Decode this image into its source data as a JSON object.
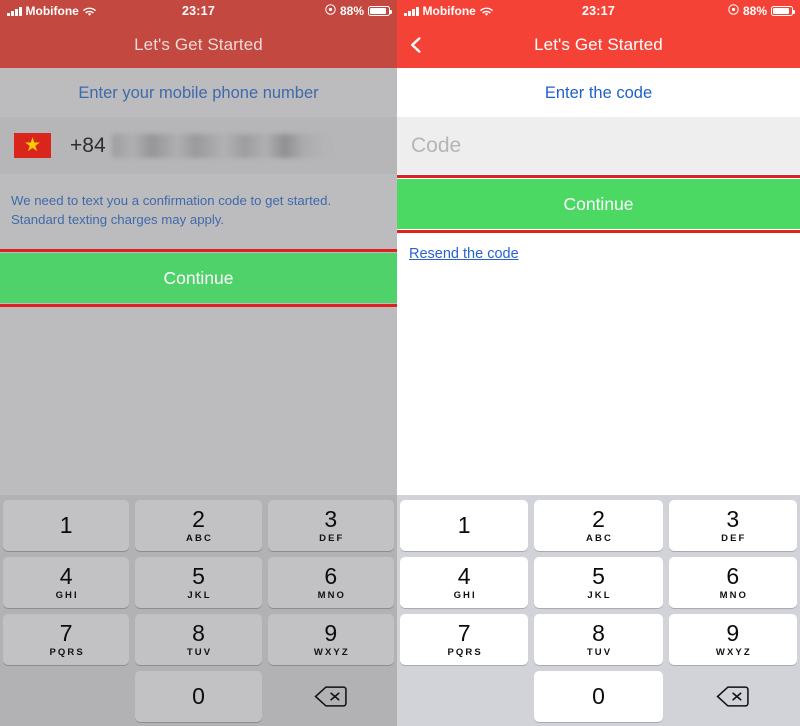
{
  "status_bar": {
    "carrier": "Mobifone",
    "time": "23:17",
    "battery_percent": "88%",
    "signal_icon": "signal-bars-icon",
    "wifi_icon": "wifi-icon",
    "alarm_icon": "alarm-clock-icon",
    "battery_icon": "battery-icon"
  },
  "colors": {
    "header_red": "#f44336",
    "header_red_dim": "#c3483f",
    "continue_green": "#4bd964",
    "link_blue": "#2b62cf",
    "heading_blue": "#1f5fd0",
    "annotation_red": "#e02020",
    "flag_red": "#da251d",
    "flag_star_yellow": "#ffcd00"
  },
  "left_screen": {
    "nav_title": "Let's Get Started",
    "heading": "Enter your mobile phone number",
    "flag_icon": "vietnam-flag-icon",
    "dial_code": "+84",
    "phone_number_masked": "",
    "note": "We need to text you a confirmation code to get started. Standard texting charges may apply.",
    "continue_label": "Continue"
  },
  "right_screen": {
    "nav_title": "Let's Get Started",
    "back_icon": "chevron-left-icon",
    "heading": "Enter the code",
    "code_placeholder": "Code",
    "code_value": "",
    "continue_label": "Continue",
    "resend_label": "Resend the code"
  },
  "keypad": {
    "keys": [
      {
        "num": "1",
        "letters": ""
      },
      {
        "num": "2",
        "letters": "ABC"
      },
      {
        "num": "3",
        "letters": "DEF"
      },
      {
        "num": "4",
        "letters": "GHI"
      },
      {
        "num": "5",
        "letters": "JKL"
      },
      {
        "num": "6",
        "letters": "MNO"
      },
      {
        "num": "7",
        "letters": "PQRS"
      },
      {
        "num": "8",
        "letters": "TUV"
      },
      {
        "num": "9",
        "letters": "WXYZ"
      },
      {
        "num": "0",
        "letters": ""
      }
    ],
    "delete_icon": "backspace-delete-icon"
  }
}
